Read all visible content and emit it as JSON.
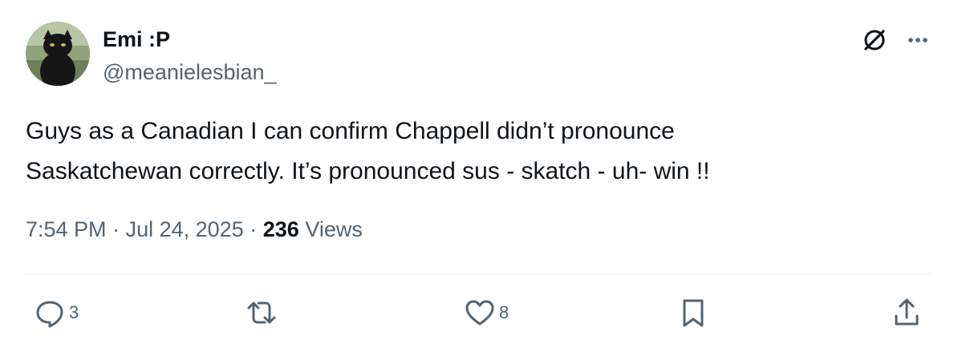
{
  "user": {
    "display_name": "Emi :P",
    "handle": "@meanielesbian_"
  },
  "tweet": {
    "lines": [
      "Guys as a Canadian I can confirm Chappell didn’t pronounce",
      "Saskatchewan correctly. It’s pronounced sus - skatch - uh- win !!"
    ]
  },
  "meta": {
    "time": "7:54 PM",
    "separator": "·",
    "date": "Jul 24, 2025",
    "views_count": "236",
    "views_label": "Views"
  },
  "actions": {
    "reply_count": "3",
    "like_count": "8"
  },
  "icons": {
    "grok": "grok-icon",
    "more": "more-horizontal-icon",
    "reply": "reply-icon",
    "repost": "repost-icon",
    "like": "heart-icon",
    "bookmark": "bookmark-icon",
    "share": "share-icon"
  },
  "colors": {
    "text_primary": "#0f1419",
    "text_secondary": "#536471",
    "divider": "#eff3f4"
  }
}
